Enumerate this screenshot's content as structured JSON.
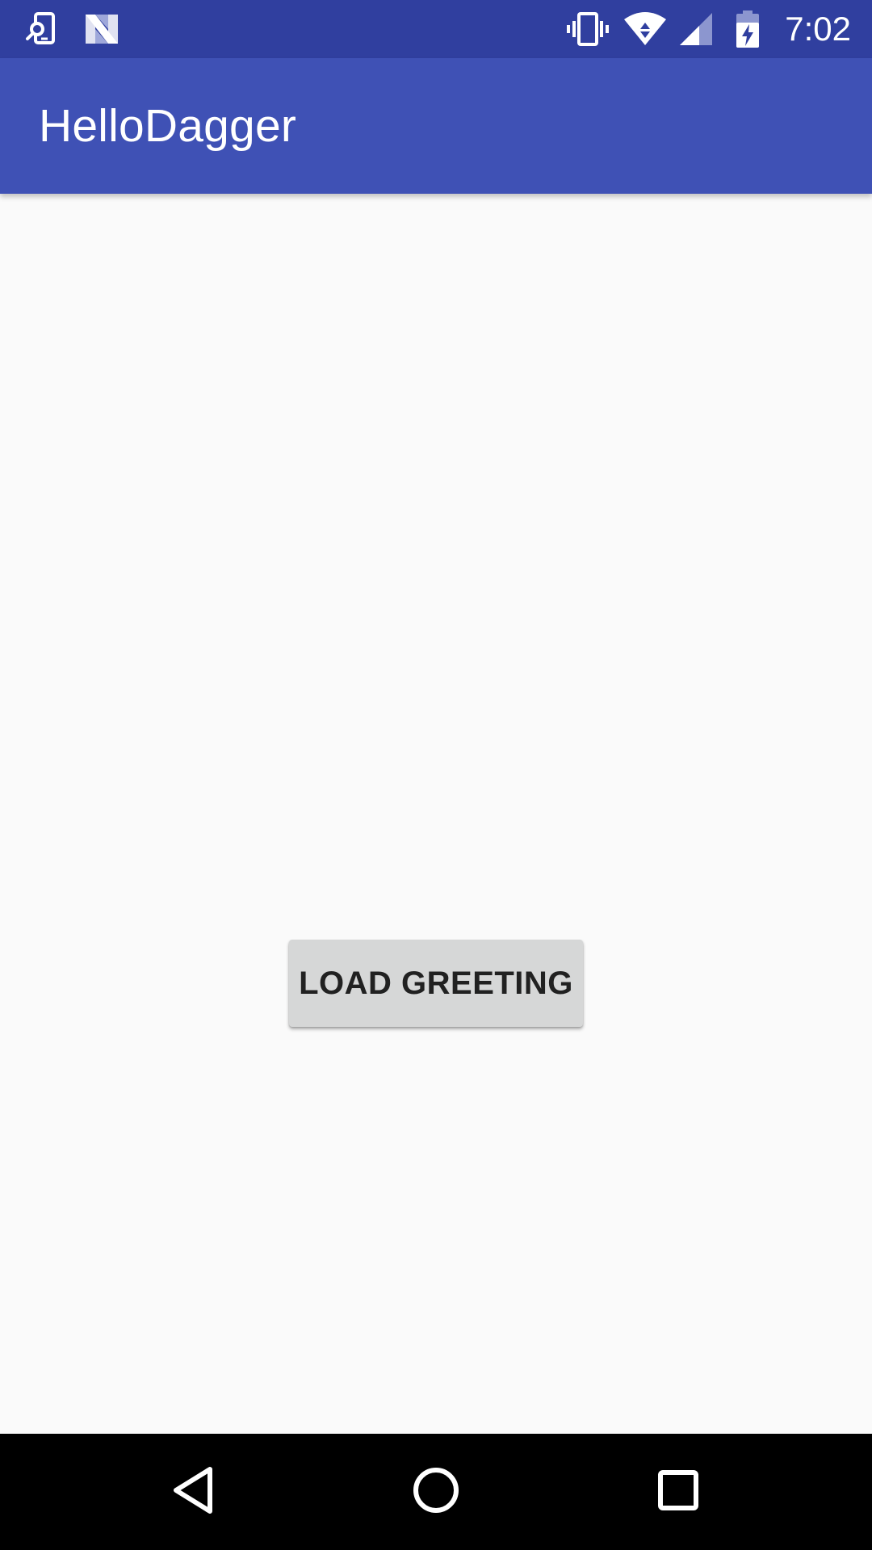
{
  "status_bar": {
    "time": "7:02",
    "left_icons": [
      "phone-search-icon",
      "n-preview-icon"
    ],
    "right_icons": [
      "vibrate-icon",
      "wifi-icon",
      "cell-signal-icon",
      "battery-charging-icon"
    ],
    "background": "#303f9f"
  },
  "app_bar": {
    "title": "HelloDagger",
    "background": "#3f51b5"
  },
  "main": {
    "load_button_label": "LOAD GREETING",
    "background": "#fafafa"
  },
  "nav_bar": {
    "buttons": [
      "back-icon",
      "home-icon",
      "recents-icon"
    ],
    "background": "#000000"
  }
}
